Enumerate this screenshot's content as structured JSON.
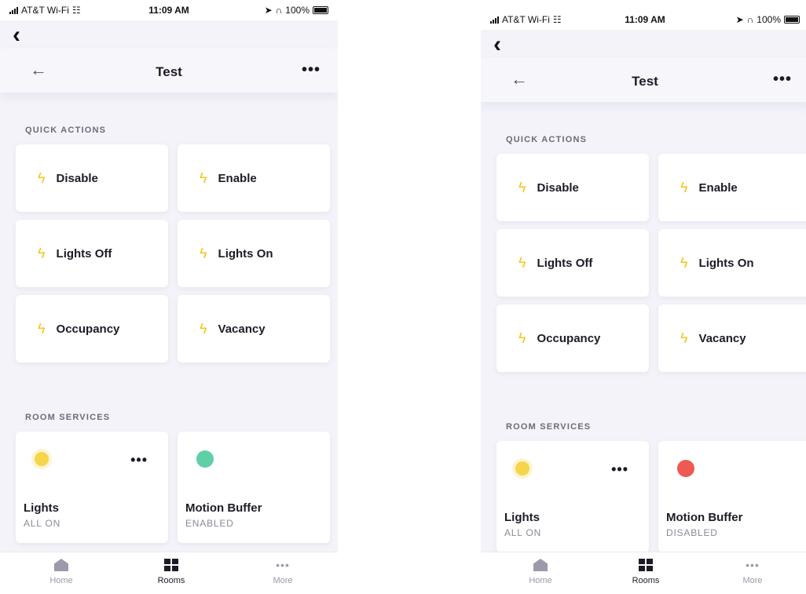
{
  "screens": [
    {
      "status_bar": {
        "carrier": "AT&T Wi-Fi",
        "time": "11:09 AM",
        "battery": "100%"
      },
      "header": {
        "title": "Test"
      },
      "quick_actions": {
        "label": "QUICK ACTIONS",
        "items": [
          {
            "label": "Disable"
          },
          {
            "label": "Enable"
          },
          {
            "label": "Lights Off"
          },
          {
            "label": "Lights On"
          },
          {
            "label": "Occupancy"
          },
          {
            "label": "Vacancy"
          }
        ]
      },
      "room_services": {
        "label": "ROOM SERVICES",
        "lights": {
          "name": "Lights",
          "status": "ALL ON"
        },
        "motion_buffer": {
          "name": "Motion Buffer",
          "status": "ENABLED",
          "indicator_color": "#5fcfa6"
        }
      },
      "tabs": [
        {
          "label": "Home",
          "icon": "home-icon"
        },
        {
          "label": "Rooms",
          "icon": "rooms-icon",
          "active": true
        },
        {
          "label": "More",
          "icon": "more-icon"
        }
      ]
    },
    {
      "status_bar": {
        "carrier": "AT&T Wi-Fi",
        "time": "11:09 AM",
        "battery": "100%"
      },
      "header": {
        "title": "Test"
      },
      "quick_actions": {
        "label": "QUICK ACTIONS",
        "items": [
          {
            "label": "Disable"
          },
          {
            "label": "Enable"
          },
          {
            "label": "Lights Off"
          },
          {
            "label": "Lights On"
          },
          {
            "label": "Occupancy"
          },
          {
            "label": "Vacancy"
          }
        ]
      },
      "room_services": {
        "label": "ROOM SERVICES",
        "lights": {
          "name": "Lights",
          "status": "ALL ON"
        },
        "motion_buffer": {
          "name": "Motion Buffer",
          "status": "DISABLED",
          "indicator_color": "#ee5a52"
        }
      },
      "tabs": [
        {
          "label": "Home",
          "icon": "home-icon"
        },
        {
          "label": "Rooms",
          "icon": "rooms-icon",
          "active": true
        },
        {
          "label": "More",
          "icon": "more-icon"
        }
      ]
    }
  ]
}
